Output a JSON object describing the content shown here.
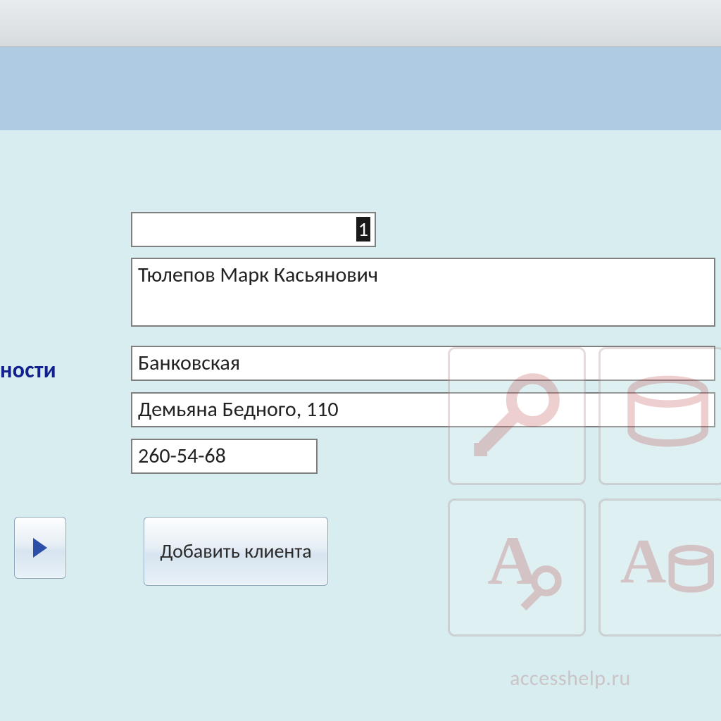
{
  "label_partial": "ности",
  "fields": {
    "id": "1",
    "name": "Тюлепов Марк Касьянович",
    "activity": "Банковская",
    "address": "Демьяна Бедного, 110",
    "phone": "260-54-68"
  },
  "buttons": {
    "add_client": "Добавить клиента"
  },
  "watermark_text": "accesshelp.ru"
}
